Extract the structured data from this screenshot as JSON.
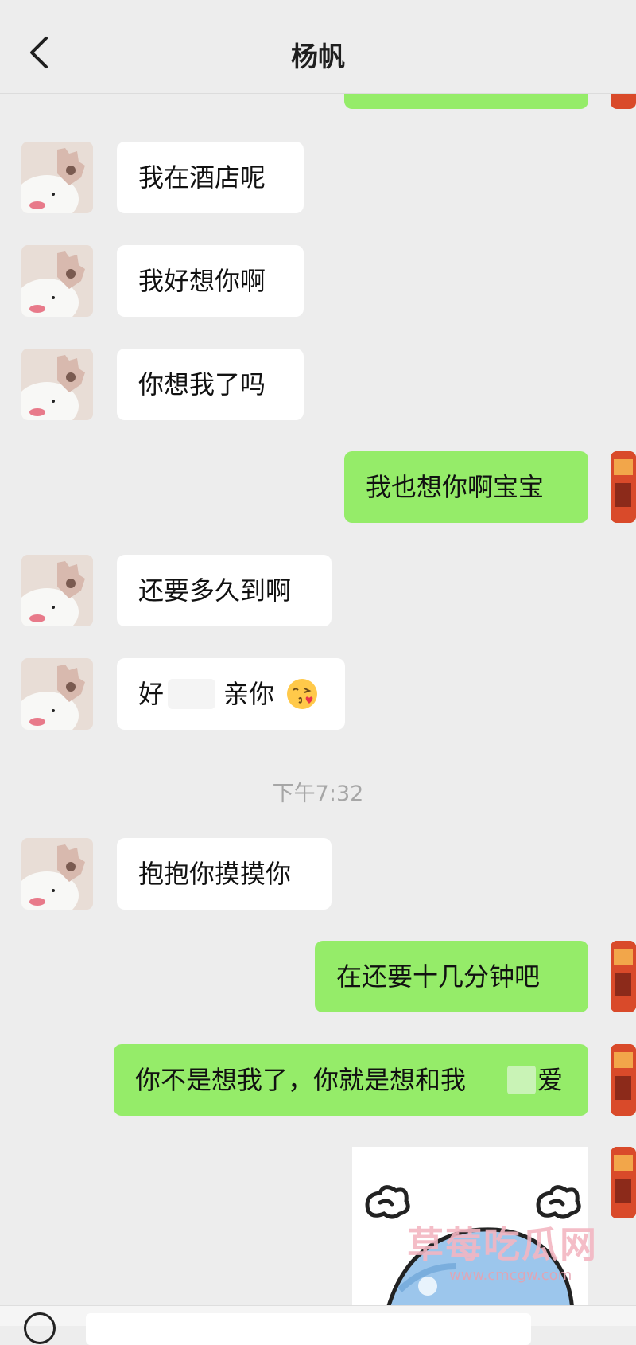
{
  "header": {
    "title": "杨帆",
    "back_icon": "chevron-left-icon"
  },
  "messages": [
    {
      "side": "right",
      "text": ""
    },
    {
      "side": "left",
      "text": "我在酒店呢"
    },
    {
      "side": "left",
      "text": "我好想你啊"
    },
    {
      "side": "left",
      "text": "你想我了吗"
    },
    {
      "side": "right",
      "text": "我也想你啊宝宝"
    },
    {
      "side": "left",
      "text": "还要多久到啊"
    },
    {
      "side": "left",
      "text": "好",
      "text_b": "亲你",
      "emoji": "😘"
    },
    {
      "side": "left",
      "text": "抱抱你摸摸你"
    },
    {
      "side": "right",
      "text": "在还要十几分钟吧"
    },
    {
      "side": "right",
      "text": "你不是想我了，你就是想和我",
      "text_b": "爱"
    }
  ],
  "timestamp": "下午7:32",
  "sticker": {
    "icon": "whale-sticker"
  },
  "watermark": {
    "main": "草莓吃瓜网",
    "sub": "www.cmcgw.com"
  },
  "colors": {
    "background": "#ededed",
    "bubble_left": "#ffffff",
    "bubble_right": "#95ec69",
    "timestamp": "#a6a6a6"
  }
}
